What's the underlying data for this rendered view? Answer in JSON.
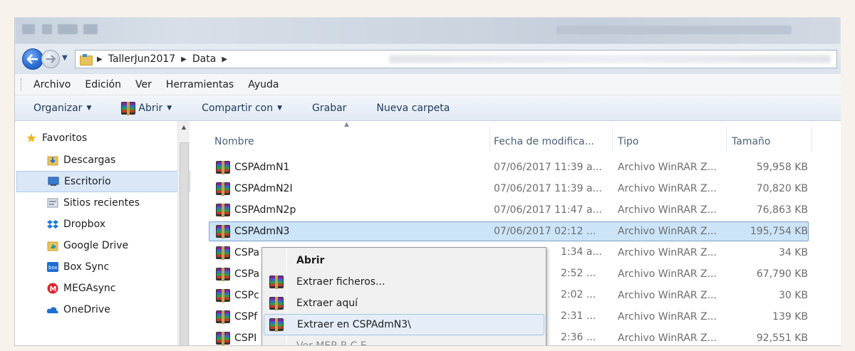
{
  "address": {
    "crumbs": [
      "TallerJun2017",
      "Data"
    ]
  },
  "menubar": {
    "items": [
      "Archivo",
      "Edición",
      "Ver",
      "Herramientas",
      "Ayuda"
    ]
  },
  "commandbar": {
    "organize": "Organizar",
    "open": "Abrir",
    "share": "Compartir con",
    "burn": "Grabar",
    "new_folder": "Nueva carpeta"
  },
  "navpane": {
    "favorites": "Favoritos",
    "items": [
      "Descargas",
      "Escritorio",
      "Sitios recientes",
      "Dropbox",
      "Google Drive",
      "Box Sync",
      "MEGAsync",
      "OneDrive"
    ],
    "selected": "Escritorio"
  },
  "columns": {
    "name": "Nombre",
    "date": "Fecha de modifica...",
    "type": "Tipo",
    "size": "Tamaño"
  },
  "files": [
    {
      "name": "CSPAdmN1",
      "date": "07/06/2017 11:39 a...",
      "type": "Archivo WinRAR Z...",
      "size": "59,958 KB"
    },
    {
      "name": "CSPAdmN2I",
      "date": "07/06/2017 11:39 a...",
      "type": "Archivo WinRAR Z...",
      "size": "70,820 KB"
    },
    {
      "name": "CSPAdmN2p",
      "date": "07/06/2017 11:47 a...",
      "type": "Archivo WinRAR Z...",
      "size": "76,863 KB"
    },
    {
      "name": "CSPAdmN3",
      "date": "07/06/2017 02:12 ...",
      "type": "Archivo WinRAR Z...",
      "size": "195,754 KB"
    },
    {
      "name": "CSPa",
      "date": "1:34 a...",
      "type": "Archivo WinRAR Z...",
      "size": "34 KB"
    },
    {
      "name": "CSPa",
      "date": "2:52 ...",
      "type": "Archivo WinRAR Z...",
      "size": "67,790 KB"
    },
    {
      "name": "CSPc",
      "date": "2:02 ...",
      "type": "Archivo WinRAR Z...",
      "size": "30 KB"
    },
    {
      "name": "CSPf",
      "date": "2:31 ...",
      "type": "Archivo WinRAR Z...",
      "size": "139 KB"
    },
    {
      "name": "CSPI",
      "date": "2:36 ...",
      "type": "Archivo WinRAR Z...",
      "size": "92,551 KB"
    }
  ],
  "context_menu": {
    "items": [
      "Abrir",
      "Extraer ficheros...",
      "Extraer aquí",
      "Extraer en CSPAdmN3\\",
      "Ver MER.R.C.E..."
    ]
  }
}
